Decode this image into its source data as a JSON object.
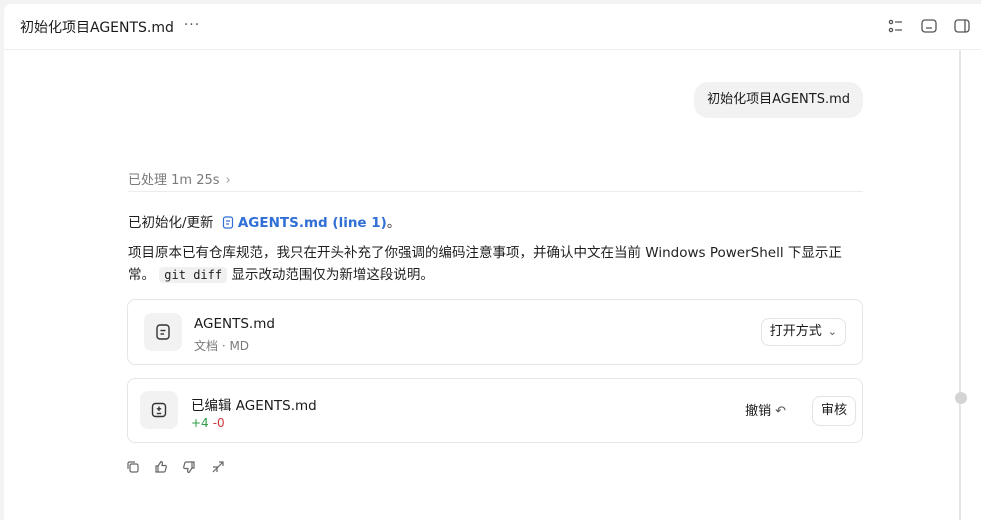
{
  "header": {
    "title": "初始化项目AGENTS.md",
    "more_label": "···",
    "icons": [
      "checklist-icon",
      "terminal-panel-icon",
      "sidebar-toggle-icon"
    ]
  },
  "conversation": {
    "user_message": "初始化项目AGENTS.md",
    "processed": {
      "label": "已处理 1m 25s",
      "chevron": "›"
    },
    "reply": {
      "line1_prefix": "已初始化/更新",
      "file_link": "AGENTS.md (line 1)",
      "line1_suffix": "。",
      "para_part1": "项目原本已有仓库规范，我只在开头补充了你强调的编码注意事项，并确认中文在当前 Windows PowerShell 下显示正常。",
      "code": "git diff",
      "para_part2": "显示改动范围仅为新增这段说明。"
    },
    "file_card": {
      "name": "AGENTS.md",
      "meta": "文档 · MD",
      "open_with": "打开方式",
      "chevron": "⌄"
    },
    "edit_card": {
      "title": "已编辑 AGENTS.md",
      "added": "+4",
      "removed": "-0",
      "undo": "撤销",
      "undo_icon": "↶",
      "review": "审核"
    },
    "action_icons": [
      "copy-icon",
      "thumbs-up-icon",
      "thumbs-down-icon",
      "fork-icon"
    ]
  },
  "colors": {
    "link": "#2f6fd6",
    "diff_add": "#2e9e44",
    "diff_remove": "#d0393e",
    "bubble": "#f2f2f2"
  }
}
